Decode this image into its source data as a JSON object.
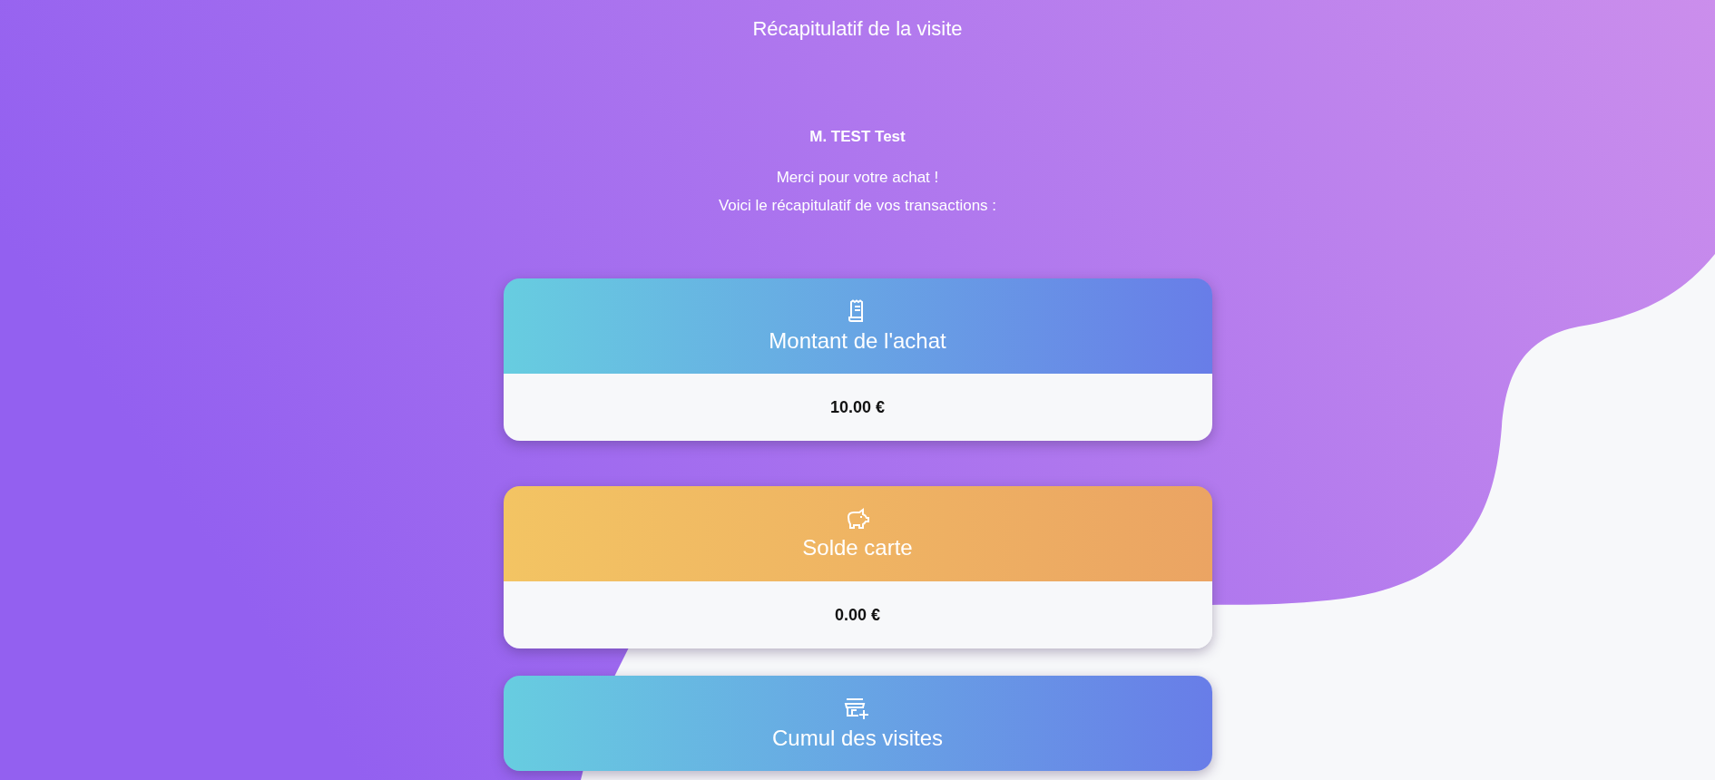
{
  "title": "Récapitulatif de la visite",
  "customer": "M. TEST Test",
  "message_lines": [
    "Merci pour votre achat !",
    "Voici le récapitulatif de vos transactions :"
  ],
  "cards": [
    {
      "kind": "receipt",
      "label": "Montant de l'achat",
      "value": "10.00 €"
    },
    {
      "kind": "savings",
      "label": "Solde carte",
      "value": "0.00 €"
    },
    {
      "kind": "visits",
      "label": "Cumul des visites"
    }
  ]
}
